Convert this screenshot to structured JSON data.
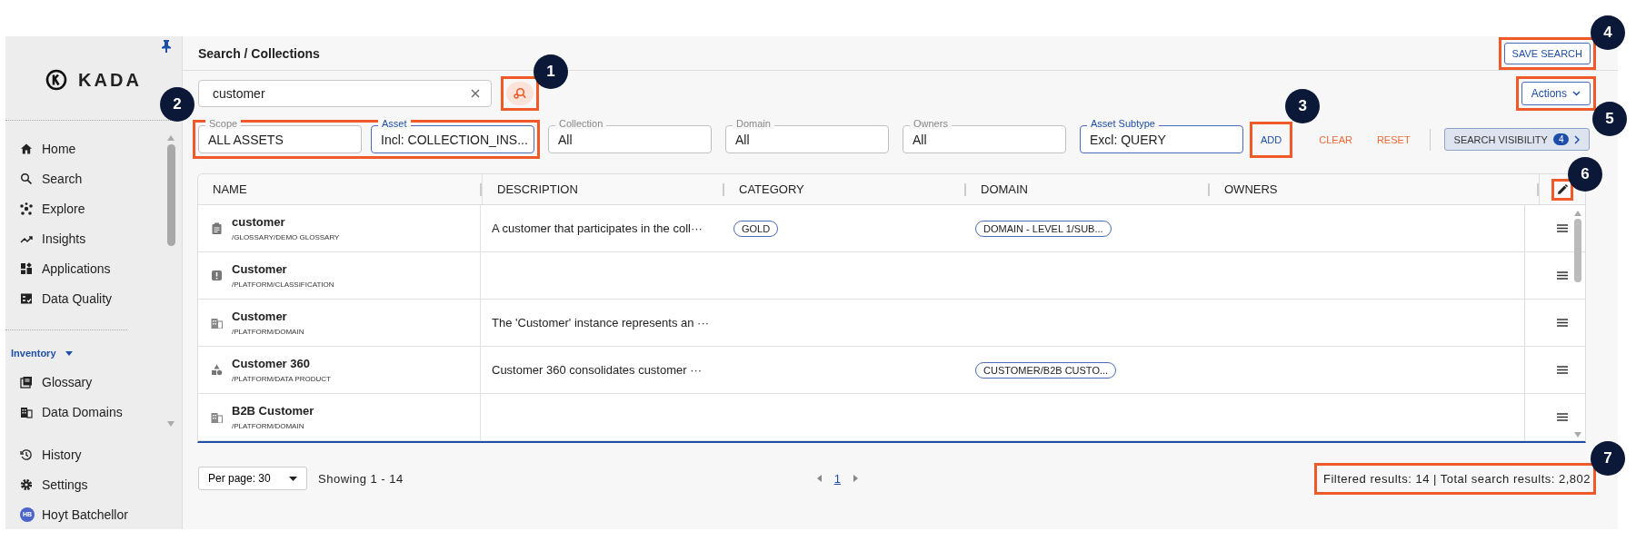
{
  "sidebar": {
    "logo": "KADA",
    "pinned": true,
    "nav": [
      {
        "label": "Home",
        "kind": "home"
      },
      {
        "label": "Search",
        "kind": "search"
      },
      {
        "label": "Explore",
        "kind": "explore"
      },
      {
        "label": "Insights",
        "kind": "insights"
      },
      {
        "label": "Applications",
        "kind": "applications"
      },
      {
        "label": "Data Quality",
        "kind": "quality"
      }
    ],
    "section": {
      "label": "Inventory",
      "expanded": true,
      "items": [
        {
          "label": "Glossary",
          "kind": "glossary"
        },
        {
          "label": "Data Domains",
          "kind": "domains"
        }
      ]
    },
    "bottom": [
      {
        "label": "History",
        "kind": "history"
      },
      {
        "label": "Settings",
        "kind": "settings"
      }
    ],
    "user": {
      "initials": "HB",
      "name": "Hoyt Batchellor"
    }
  },
  "header": {
    "breadcrumb": "Search / Collections",
    "save_button": {
      "label": "SAVE SEARCH",
      "callout": {
        "number": "4"
      }
    }
  },
  "search": {
    "value": "customer",
    "advanced_button": {
      "callout": {
        "number": "1"
      }
    }
  },
  "actions_button": {
    "label": "Actions",
    "callout": {
      "number": "5"
    }
  },
  "primary_filters": {
    "callout": {
      "number": "2"
    },
    "fields": [
      {
        "label": "Scope",
        "value": "ALL ASSETS",
        "active": false
      },
      {
        "label": "Asset",
        "value": "Incl: COLLECTION_INS...",
        "active": true
      }
    ]
  },
  "filters": [
    {
      "label": "Collection",
      "value": "All",
      "active": false
    },
    {
      "label": "Domain",
      "value": "All",
      "active": false
    },
    {
      "label": "Owners",
      "value": "All",
      "active": false
    },
    {
      "label": "Asset Subtype",
      "value": "Excl: QUERY",
      "active": true
    }
  ],
  "filter_buttons": {
    "add": {
      "label": "ADD",
      "callout": {
        "number": "3"
      }
    },
    "clear": "CLEAR",
    "reset": "RESET"
  },
  "visibility_button": {
    "label": "SEARCH VISIBILITY",
    "count": "4"
  },
  "table": {
    "columns": [
      "NAME",
      "DESCRIPTION",
      "CATEGORY",
      "DOMAIN",
      "OWNERS"
    ],
    "edit_callout": {
      "number": "6"
    },
    "rows": [
      {
        "kind": "glossary",
        "name": "customer",
        "path": "/GLOSSARY/DEMO GLOSSARY",
        "description": "A customer that participates in the coll···",
        "categories": [
          "GOLD"
        ],
        "domains": [
          "DOMAIN - LEVEL 1/SUB..."
        ]
      },
      {
        "kind": "classification",
        "name": "Customer",
        "path": "/PLATFORM/CLASSIFICATION"
      },
      {
        "kind": "domain",
        "name": "Customer",
        "path": "/PLATFORM/DOMAIN",
        "description": "The 'Customer' instance represents an ···"
      },
      {
        "kind": "product",
        "name": "Customer 360",
        "path": "/PLATFORM/DATA PRODUCT",
        "description": "Customer 360 consolidates customer ···",
        "domains": [
          "CUSTOMER/B2B CUSTO..."
        ]
      },
      {
        "kind": "domain",
        "name": "B2B Customer",
        "path": "/PLATFORM/DOMAIN"
      }
    ]
  },
  "footer": {
    "per_page": "Per page: 30",
    "showing": "Showing 1 - 14",
    "page": "1",
    "results": "Filtered results: 14 |  Total search results: 2,802",
    "results_callout": {
      "number": "7"
    }
  }
}
